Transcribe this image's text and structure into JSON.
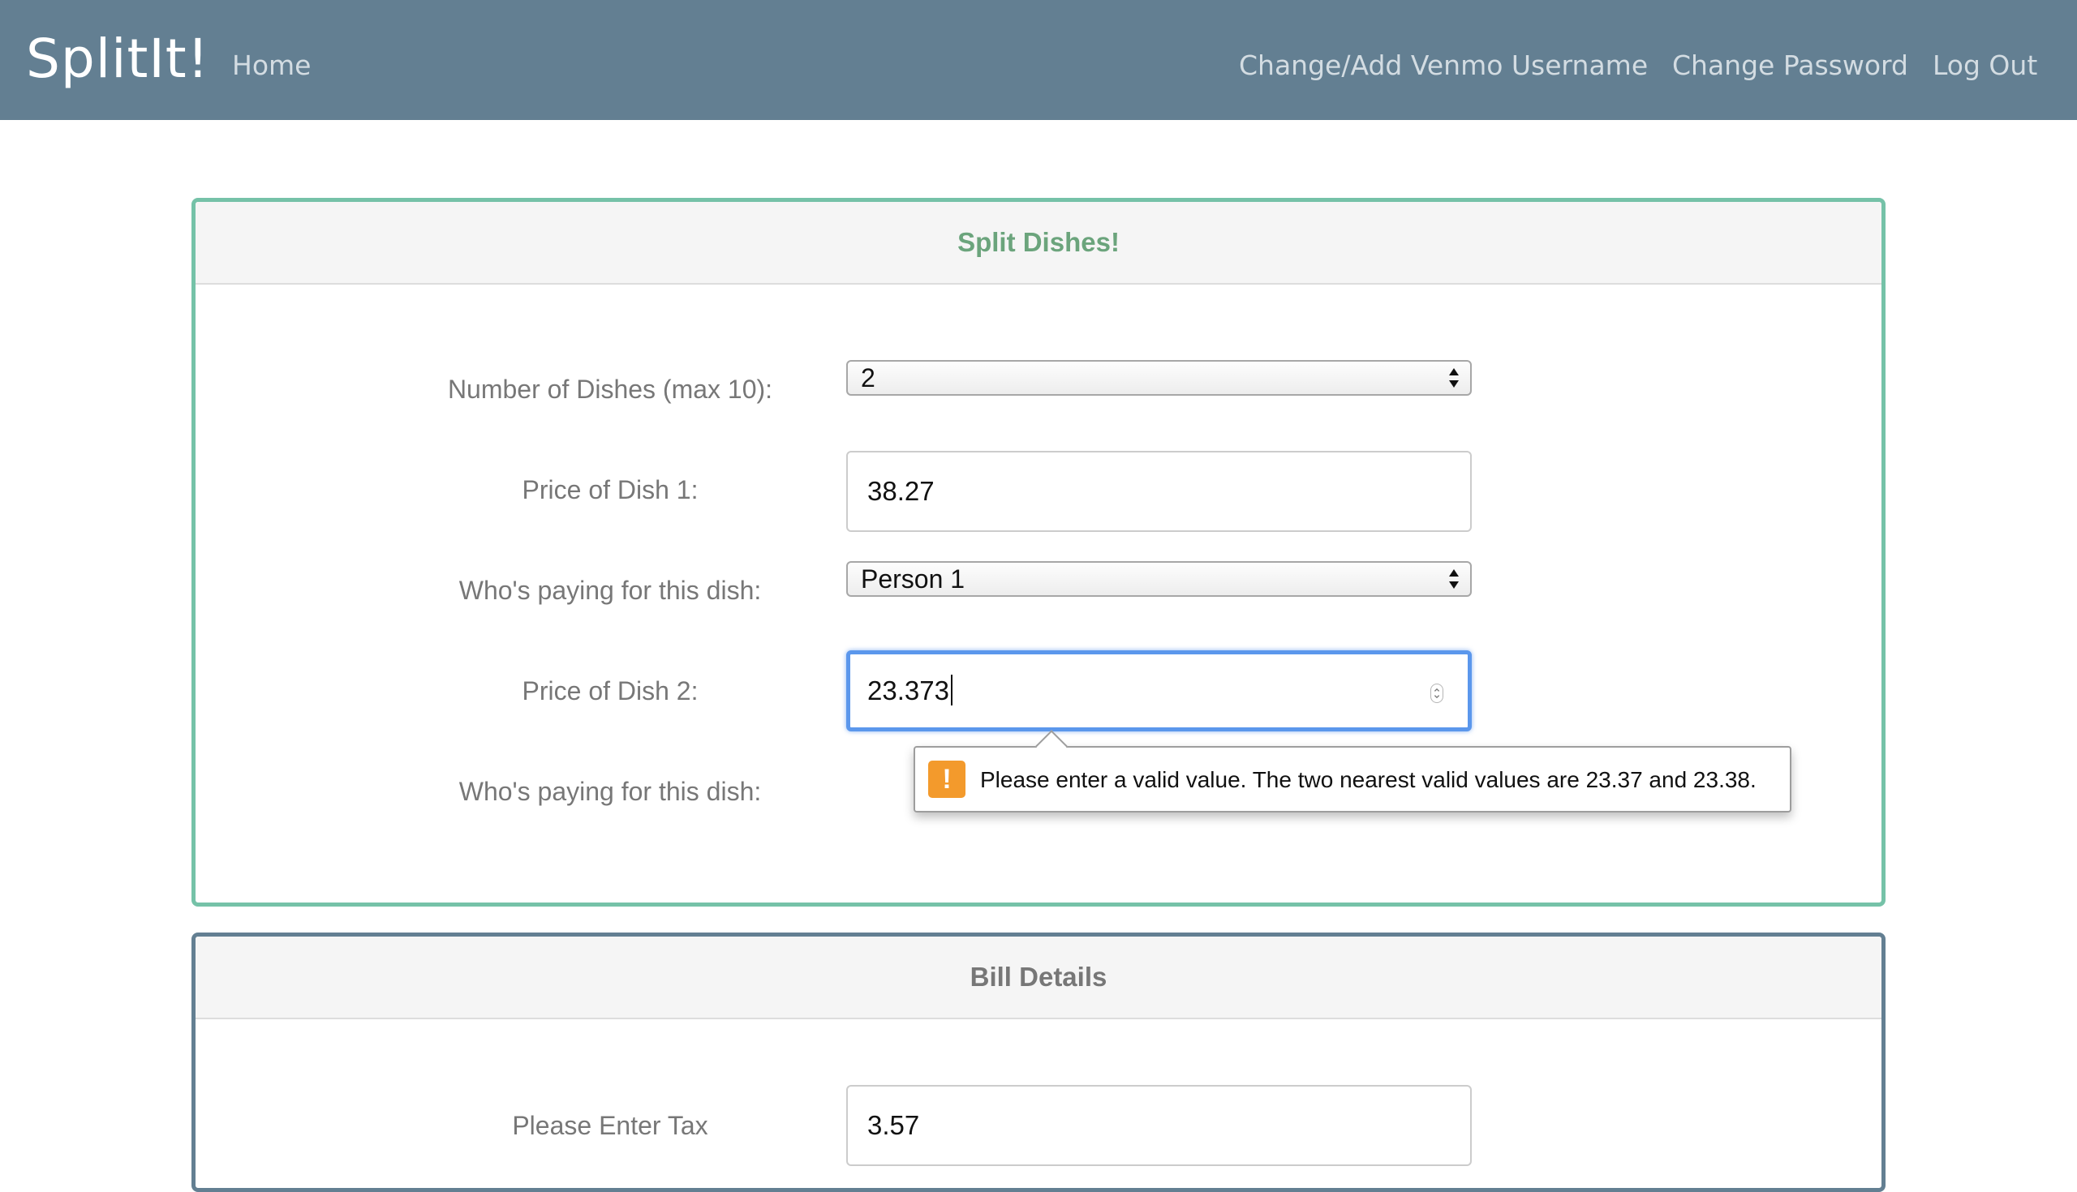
{
  "navbar": {
    "brand": "SplitIt!",
    "home": "Home",
    "venmo": "Change/Add Venmo Username",
    "password": "Change Password",
    "logout": "Log Out"
  },
  "dishes_panel": {
    "title": "Split Dishes!",
    "num_dishes_label": "Number of Dishes (max 10):",
    "num_dishes_value": "2",
    "dish1_price_label": "Price of Dish 1:",
    "dish1_price_value": "38.27",
    "dish1_payer_label": "Who's paying for this dish:",
    "dish1_payer_value": "Person 1",
    "dish2_price_label": "Price of Dish 2:",
    "dish2_price_value": "23.373",
    "dish2_payer_label": "Who's paying for this dish:"
  },
  "validation": {
    "icon": "warning-icon",
    "message": "Please enter a valid value. The two nearest valid values are 23.37 and 23.38."
  },
  "bill_panel": {
    "title": "Bill Details",
    "tax_label": "Please Enter Tax",
    "tax_value": "3.57"
  },
  "colors": {
    "navbar": "#637f92",
    "dishes_border": "#75c2a8",
    "dishes_title": "#6ba47c",
    "bill_border": "#637f92",
    "focus": "#5b97ec",
    "warning": "#f39a2c"
  }
}
